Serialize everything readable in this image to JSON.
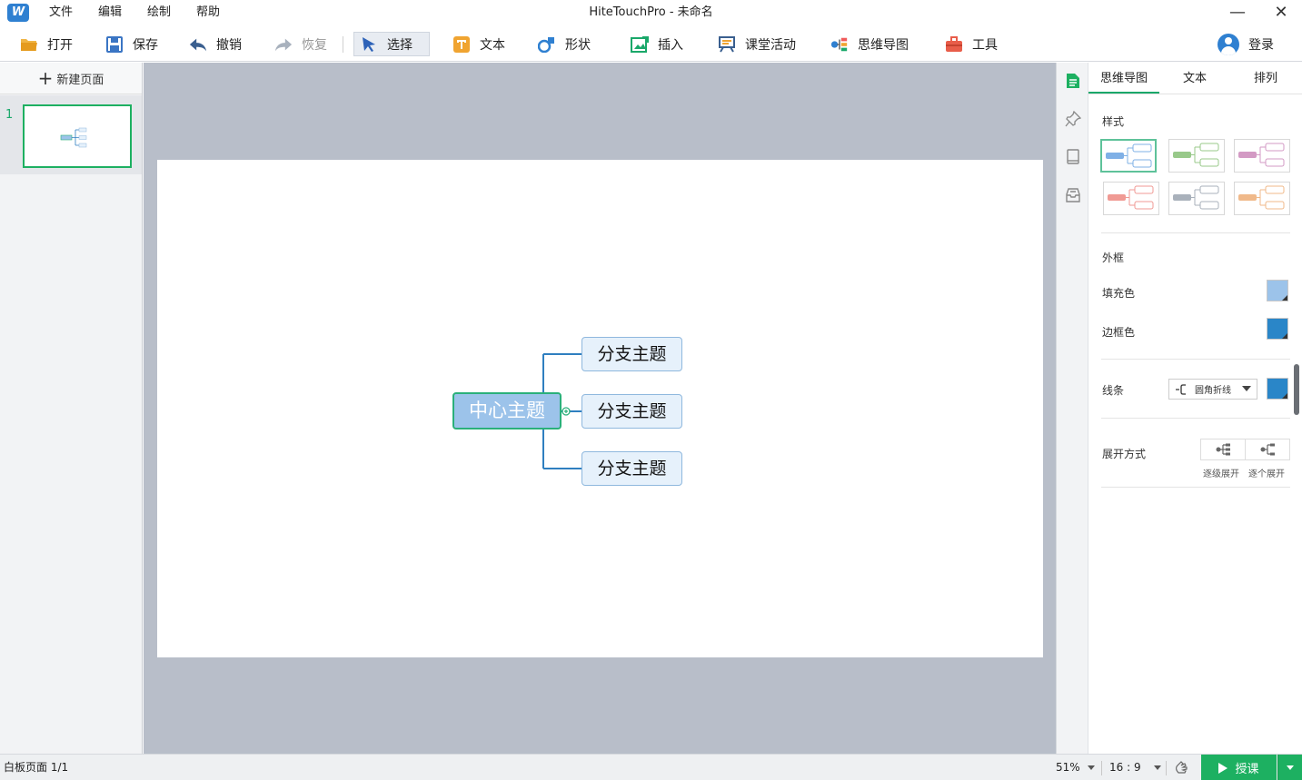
{
  "window": {
    "title": "HiteTouchPro - 未命名",
    "logo_text": "W",
    "minimize_glyph": "—",
    "close_glyph": "✕"
  },
  "menu": [
    "文件",
    "编辑",
    "绘制",
    "帮助"
  ],
  "toolbar": {
    "open": "打开",
    "save": "保存",
    "undo": "撤销",
    "redo": "恢复",
    "select": "选择",
    "text": "文本",
    "shape": "形状",
    "insert": "插入",
    "activity": "课堂活动",
    "mindmap": "思维导图",
    "tools": "工具",
    "login": "登录"
  },
  "pages": {
    "new_page": "新建页面",
    "plus_glyph": "+",
    "items": [
      {
        "number": "1"
      }
    ]
  },
  "mindmap": {
    "center": "中心主题",
    "branches": [
      "分支主题",
      "分支主题",
      "分支主题"
    ],
    "line_color": "#2f7fc0",
    "center_fill": "#9cc3ea",
    "center_border": "#2ab07a"
  },
  "props": {
    "tabs": [
      "思维导图",
      "文本",
      "排列"
    ],
    "style_label": "样式",
    "style_colors": [
      "#7fb0e6",
      "#98c98a",
      "#d39ac4",
      "#f09a94",
      "#a9b1bb",
      "#f0b98a"
    ],
    "frame_label": "外框",
    "fill_label": "填充色",
    "fill_color": "#9cc3ea",
    "border_label": "边框色",
    "border_color": "#2a86c8",
    "line_label": "线条",
    "line_style": "圆角折线",
    "line_color": "#2a86c8",
    "expand_label": "展开方式",
    "expand_level": "逐级展开",
    "expand_each": "逐个展开"
  },
  "status": {
    "page_info": "白板页面 1/1",
    "zoom": "51%",
    "ratio": "16 : 9",
    "teach": "授课"
  },
  "accent_color": "#1db061"
}
